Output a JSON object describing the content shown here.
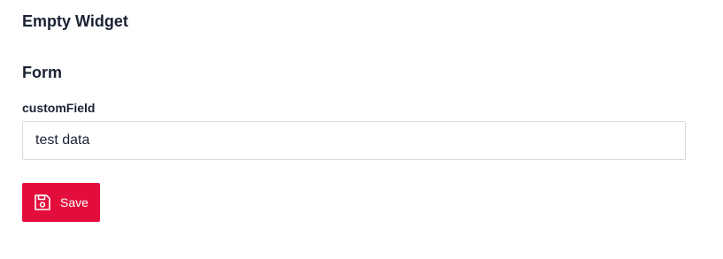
{
  "widget": {
    "title": "Empty Widget"
  },
  "form": {
    "title": "Form",
    "fields": [
      {
        "label": "customField",
        "value": "test data"
      }
    ],
    "save_button": {
      "label": "Save",
      "icon": "floppy-disk-icon"
    }
  },
  "colors": {
    "accent": "#e30d3c",
    "text": "#1a2233",
    "input_border": "#d7d9dd"
  }
}
